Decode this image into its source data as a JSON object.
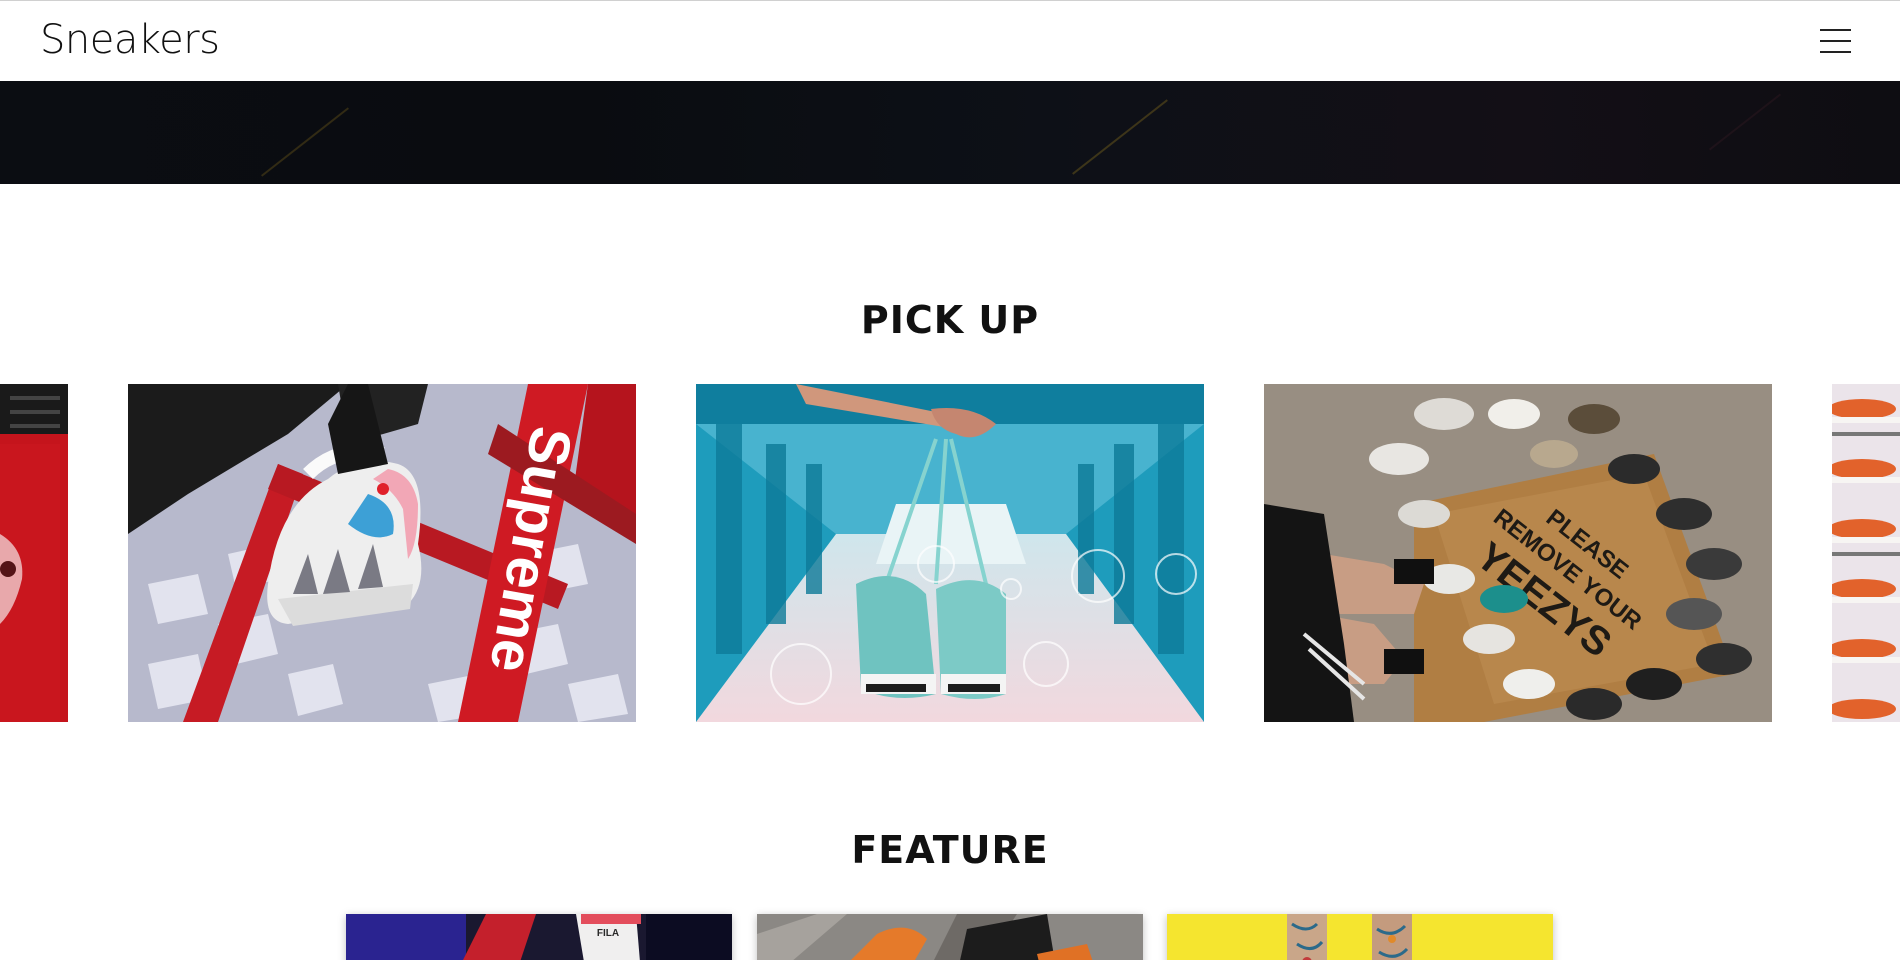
{
  "header": {
    "logo": "Sneakers",
    "menu_icon": "hamburger-menu-icon"
  },
  "hero": {
    "colors": {
      "base": "#0b0d12",
      "streak_yellow": "#6b5a1c"
    }
  },
  "pickup": {
    "title": "PICK UP",
    "slides": [
      {
        "name": "red-shoe-partial"
      },
      {
        "name": "supreme-sneaker",
        "mat_text": "Supreme"
      },
      {
        "name": "teal-bridge-sneakers"
      },
      {
        "name": "yeezy-circle",
        "doormat_text": "PLEASE REMOVE YOUR YEEZYS"
      },
      {
        "name": "orange-sneakers-partial"
      }
    ]
  },
  "feature": {
    "title": "FEATURE",
    "cards": [
      {
        "name": "feature-card-fila",
        "brand_text": "FILA"
      },
      {
        "name": "feature-card-orange"
      },
      {
        "name": "feature-card-yellow"
      }
    ]
  }
}
